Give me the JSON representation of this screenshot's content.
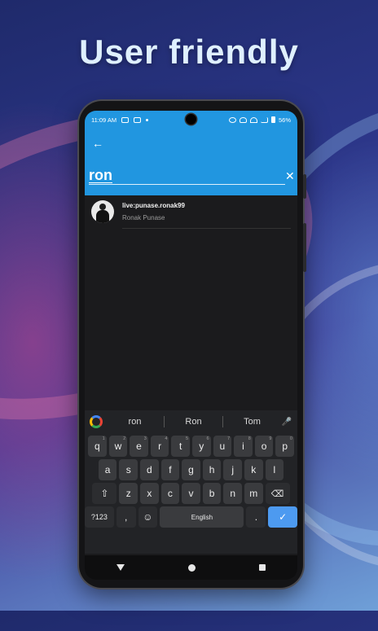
{
  "headline": "User friendly",
  "status": {
    "time": "11:09 AM",
    "battery": "56%"
  },
  "search": {
    "query": "ron"
  },
  "results": [
    {
      "title": "live:punase.ronak99",
      "subtitle": "Ronak Punase"
    }
  ],
  "keyboard": {
    "suggestions": [
      "ron",
      "Ron",
      "Tom"
    ],
    "row1": [
      {
        "k": "q",
        "h": "1"
      },
      {
        "k": "w",
        "h": "2"
      },
      {
        "k": "e",
        "h": "3"
      },
      {
        "k": "r",
        "h": "4"
      },
      {
        "k": "t",
        "h": "5"
      },
      {
        "k": "y",
        "h": "6"
      },
      {
        "k": "u",
        "h": "7"
      },
      {
        "k": "i",
        "h": "8"
      },
      {
        "k": "o",
        "h": "9"
      },
      {
        "k": "p",
        "h": "0"
      }
    ],
    "row2": [
      "a",
      "s",
      "d",
      "f",
      "g",
      "h",
      "j",
      "k",
      "l"
    ],
    "row3": [
      "z",
      "x",
      "c",
      "v",
      "b",
      "n",
      "m"
    ],
    "symbols_label": "?123",
    "comma": ",",
    "period": ".",
    "space_label": "English"
  },
  "colors": {
    "accent": "#2196e0",
    "enter": "#4d9af0"
  }
}
